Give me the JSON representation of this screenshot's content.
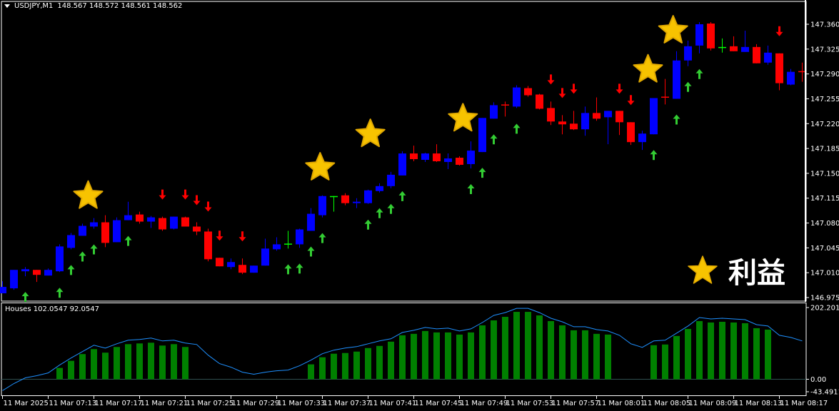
{
  "header": {
    "symbol": "USDJPY,M1",
    "ohlc": "148.567 148.572 148.561 148.562"
  },
  "indicator": {
    "label": "Houses 102.0547 92.0547",
    "axis_labels": [
      "202.201",
      "0.00",
      "-43.4911"
    ]
  },
  "legend": {
    "label": "利益",
    "icon": "star-icon"
  },
  "colors": {
    "background": "#000000",
    "bull": "#0000ff",
    "bear": "#ff0000",
    "doji": "#00ff00",
    "up_arrow": "#33cc33",
    "down_arrow": "#ff0000",
    "star": "#f7c300",
    "histogram": "#008000",
    "signal_line": "#1e90ff",
    "frame": "#ffffff"
  },
  "chart_data": [
    {
      "type": "candlestick",
      "title": "USDJPY,M1",
      "ylim": [
        146.975,
        147.36
      ],
      "price_ticks": [
        "147.360",
        "147.325",
        "147.290",
        "147.255",
        "147.220",
        "147.185",
        "147.150",
        "147.115",
        "147.080",
        "147.045",
        "147.010",
        "146.975"
      ],
      "time_labels": [
        "11 Mar 2025",
        "11 Mar 07:13",
        "11 Mar 07:17",
        "11 Mar 07:21",
        "11 Mar 07:25",
        "11 Mar 07:29",
        "11 Mar 07:33",
        "11 Mar 07:37",
        "11 Mar 07:41",
        "11 Mar 07:45",
        "11 Mar 07:49",
        "11 Mar 07:53",
        "11 Mar 07:57",
        "11 Mar 08:01",
        "11 Mar 08:05",
        "11 Mar 08:09",
        "11 Mar 08:13",
        "11 Mar 08:17"
      ],
      "ohlc": [
        [
          146.981,
          146.998,
          146.981,
          146.99
        ],
        [
          146.988,
          147.014,
          146.986,
          147.014
        ],
        [
          147.012,
          147.018,
          147.005,
          147.015
        ],
        [
          147.014,
          147.014,
          146.997,
          147.007
        ],
        [
          147.006,
          147.016,
          147.006,
          147.014
        ],
        [
          147.012,
          147.05,
          147.011,
          147.047
        ],
        [
          147.045,
          147.066,
          147.043,
          147.063
        ],
        [
          147.062,
          147.079,
          147.062,
          147.076
        ],
        [
          147.075,
          147.087,
          147.072,
          147.081
        ],
        [
          147.081,
          147.091,
          147.046,
          147.052
        ],
        [
          147.053,
          147.088,
          147.053,
          147.084
        ],
        [
          147.084,
          147.11,
          147.084,
          147.091
        ],
        [
          147.092,
          147.096,
          147.079,
          147.082
        ],
        [
          147.082,
          147.09,
          147.073,
          147.088
        ],
        [
          147.087,
          147.089,
          147.069,
          147.071
        ],
        [
          147.072,
          147.089,
          147.071,
          147.089
        ],
        [
          147.088,
          147.089,
          147.075,
          147.075
        ],
        [
          147.075,
          147.081,
          147.063,
          147.068
        ],
        [
          147.068,
          147.072,
          147.026,
          147.029
        ],
        [
          147.031,
          147.031,
          147.019,
          147.019
        ],
        [
          147.018,
          147.03,
          147.015,
          147.025
        ],
        [
          147.021,
          147.03,
          147.008,
          147.01
        ],
        [
          147.01,
          147.02,
          147.01,
          147.02
        ],
        [
          147.02,
          147.058,
          147.02,
          147.044
        ],
        [
          147.043,
          147.06,
          147.041,
          147.05
        ],
        [
          147.051,
          147.069,
          147.044,
          147.051
        ],
        [
          147.05,
          147.072,
          147.045,
          147.071
        ],
        [
          147.069,
          147.101,
          147.069,
          147.093
        ],
        [
          147.091,
          147.119,
          147.088,
          147.118
        ],
        [
          147.118,
          147.118,
          147.096,
          147.118
        ],
        [
          147.119,
          147.122,
          147.105,
          147.108
        ],
        [
          147.108,
          147.115,
          147.101,
          147.11
        ],
        [
          147.108,
          147.127,
          147.107,
          147.126
        ],
        [
          147.125,
          147.136,
          147.123,
          147.132
        ],
        [
          147.132,
          147.152,
          147.129,
          147.148
        ],
        [
          147.147,
          147.181,
          147.147,
          147.178
        ],
        [
          147.178,
          147.189,
          147.167,
          147.17
        ],
        [
          147.169,
          147.179,
          147.166,
          147.178
        ],
        [
          147.178,
          147.191,
          147.166,
          147.167
        ],
        [
          147.166,
          147.178,
          147.156,
          147.171
        ],
        [
          147.172,
          147.174,
          147.161,
          147.162
        ],
        [
          147.163,
          147.195,
          147.157,
          147.182
        ],
        [
          147.18,
          147.228,
          147.18,
          147.228
        ],
        [
          147.227,
          147.25,
          147.227,
          147.246
        ],
        [
          147.247,
          147.251,
          147.23,
          147.246
        ],
        [
          147.244,
          147.274,
          147.242,
          147.271
        ],
        [
          147.27,
          147.273,
          147.258,
          147.26
        ],
        [
          147.261,
          147.262,
          147.24,
          147.241
        ],
        [
          147.242,
          147.251,
          147.218,
          147.223
        ],
        [
          147.223,
          147.232,
          147.205,
          147.219
        ],
        [
          147.22,
          147.238,
          147.211,
          147.212
        ],
        [
          147.212,
          147.244,
          147.203,
          147.235
        ],
        [
          147.235,
          147.257,
          147.224,
          147.227
        ],
        [
          147.229,
          147.238,
          147.191,
          147.238
        ],
        [
          147.238,
          147.238,
          147.204,
          147.222
        ],
        [
          147.222,
          147.222,
          147.19,
          147.194
        ],
        [
          147.194,
          147.21,
          147.183,
          147.206
        ],
        [
          147.205,
          147.256,
          147.205,
          147.256
        ],
        [
          147.258,
          147.283,
          147.247,
          147.257
        ],
        [
          147.255,
          147.322,
          147.255,
          147.309
        ],
        [
          147.309,
          147.337,
          147.301,
          147.329
        ],
        [
          147.33,
          147.363,
          147.319,
          147.36
        ],
        [
          147.361,
          147.363,
          147.323,
          147.326
        ],
        [
          147.328,
          147.34,
          147.32,
          147.328
        ],
        [
          147.329,
          147.343,
          147.322,
          147.322
        ],
        [
          147.321,
          147.351,
          147.321,
          147.328
        ],
        [
          147.328,
          147.332,
          147.305,
          147.305
        ],
        [
          147.306,
          147.33,
          147.303,
          147.32
        ],
        [
          147.319,
          147.319,
          147.267,
          147.277
        ],
        [
          147.275,
          147.297,
          147.274,
          147.293
        ],
        [
          147.294,
          147.306,
          147.279,
          147.293
        ]
      ],
      "up_arrows": [
        2,
        5,
        6,
        7,
        8,
        11,
        25,
        26,
        27,
        28,
        32,
        33,
        34,
        35,
        41,
        42,
        43,
        45,
        57,
        59,
        60,
        61
      ],
      "down_arrows": [
        14,
        16,
        17,
        18,
        19,
        21,
        48,
        49,
        50,
        54,
        55,
        68
      ],
      "star_markers": [
        {
          "bar": 7.5,
          "price": 147.118
        },
        {
          "bar": 27.8,
          "price": 147.158
        },
        {
          "bar": 32.2,
          "price": 147.205
        },
        {
          "bar": 40.3,
          "price": 147.227
        },
        {
          "bar": 56.5,
          "price": 147.296
        },
        {
          "bar": 58.7,
          "price": 147.351
        }
      ]
    },
    {
      "type": "bar+line",
      "title": "Houses",
      "ylim": [
        -43.4911,
        202.201
      ],
      "histogram": [
        null,
        null,
        null,
        null,
        null,
        32,
        52,
        71,
        85,
        75,
        91,
        99,
        101,
        103,
        95,
        99,
        91,
        null,
        null,
        null,
        null,
        null,
        null,
        null,
        null,
        null,
        null,
        42,
        62,
        72,
        74,
        78,
        88,
        94,
        106,
        124,
        128,
        136,
        132,
        132,
        126,
        132,
        152,
        166,
        176,
        190,
        190,
        180,
        164,
        152,
        138,
        138,
        128,
        126,
        null,
        null,
        null,
        96,
        98,
        122,
        142,
        164,
        160,
        162,
        160,
        158,
        144,
        140,
        null,
        null,
        null
      ],
      "line": [
        -32,
        -12,
        4,
        10,
        18,
        40,
        60,
        78,
        96,
        88,
        100,
        110,
        112,
        116,
        108,
        110,
        102,
        98,
        68,
        44,
        34,
        20,
        14,
        20,
        24,
        26,
        38,
        54,
        72,
        82,
        88,
        92,
        100,
        108,
        114,
        132,
        138,
        146,
        142,
        144,
        136,
        142,
        160,
        180,
        188,
        200,
        200,
        188,
        172,
        162,
        148,
        148,
        140,
        136,
        124,
        100,
        90,
        108,
        110,
        130,
        150,
        174,
        170,
        172,
        170,
        168,
        154,
        150,
        124,
        118,
        108
      ]
    }
  ]
}
